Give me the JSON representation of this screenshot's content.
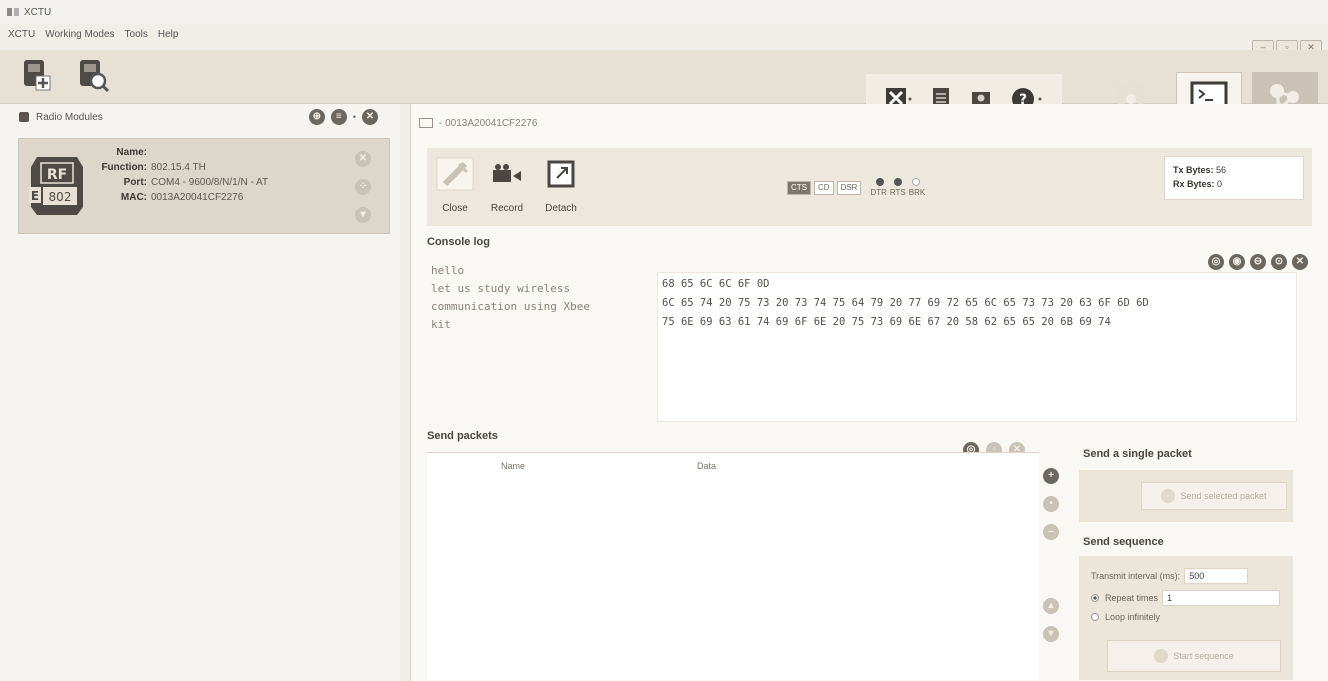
{
  "window": {
    "title": "XCTU"
  },
  "menu": [
    "XCTU",
    "Working Modes",
    "Tools",
    "Help"
  ],
  "left_panel": {
    "header": "Radio Modules",
    "module": {
      "name_label": "Name:",
      "name_value": "",
      "function_label": "Function:",
      "function_value": "802.15.4 TH",
      "port_label": "Port:",
      "port_value": "COM4 - 9600/8/N/1/N - AT",
      "mac_label": "MAC:",
      "mac_value": "0013A20041CF2276",
      "icon_text_top": "RF",
      "icon_text_bottom": "802",
      "icon_letter": "E"
    }
  },
  "console": {
    "tab_title": "- 0013A20041CF2276",
    "buttons": {
      "close": "Close",
      "record": "Record",
      "detach": "Detach"
    },
    "signals": {
      "cts": "CTS",
      "cd": "CD",
      "dsr": "DSR",
      "dtr": "DTR",
      "rts": "RTS",
      "brk": "BRK"
    },
    "tx_label": "Tx Bytes:",
    "tx_value": "56",
    "rx_label": "Rx Bytes:",
    "rx_value": "0",
    "log_label": "Console log",
    "ascii_lines": [
      "hello",
      "let us study wireless",
      "communication using Xbee",
      "kit"
    ],
    "hex_lines": [
      "68 65 6C 6C 6F 0D",
      "6C 65 74 20 75 73 20 73 74 75 64 79 20 77 69 72 65 6C 65 73 73 20 63 6F 6D 6D",
      "75 6E 69 63 61 74 69 6F 6E 20 75 73 69 6E 67 20 58 62 65 65 20 6B 69 74"
    ]
  },
  "send_packets": {
    "label": "Send packets",
    "col_name": "Name",
    "col_data": "Data",
    "single_title": "Send a single packet",
    "send_selected": "Send selected packet",
    "sequence_title": "Send sequence",
    "interval_label": "Transmit interval (ms):",
    "interval_value": "500",
    "repeat_label": "Repeat times",
    "repeat_value": "1",
    "loop_label": "Loop infinitely",
    "start_label": "Start sequence"
  }
}
